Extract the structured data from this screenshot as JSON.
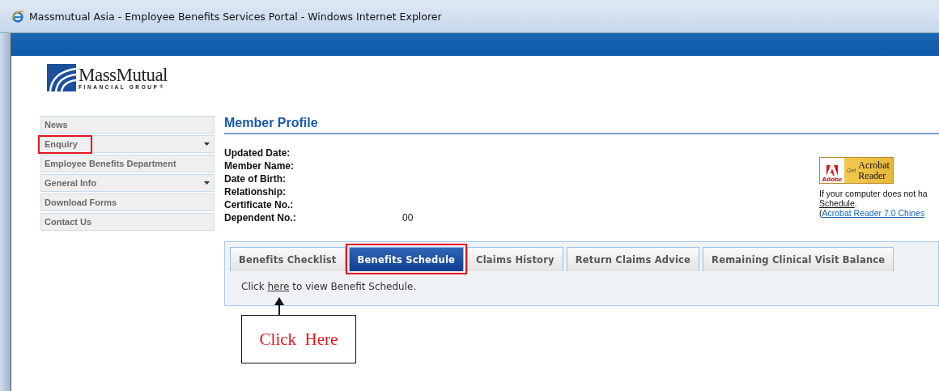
{
  "window": {
    "title": "Massmutual Asia - Employee Benefits Services Portal - Windows Internet Explorer"
  },
  "logo": {
    "name": "MassMutual",
    "tagline": "FINANCIAL GROUP",
    "mark": "®"
  },
  "sidebar": {
    "items": [
      {
        "label": "News",
        "has_submenu": false,
        "annotated": false
      },
      {
        "label": "Enquiry",
        "has_submenu": true,
        "annotated": true
      },
      {
        "label": "Employee Benefits Department",
        "has_submenu": false,
        "annotated": false
      },
      {
        "label": "General Info",
        "has_submenu": true,
        "annotated": false
      },
      {
        "label": "Download Forms",
        "has_submenu": false,
        "annotated": false
      },
      {
        "label": "Contact Us",
        "has_submenu": false,
        "annotated": false
      }
    ]
  },
  "profile": {
    "heading": "Member Profile",
    "fields": [
      {
        "label": "Updated Date:"
      },
      {
        "label": "Member Name:"
      },
      {
        "label": "Date of Birth:"
      },
      {
        "label": "Relationship:"
      },
      {
        "label": "Certificate No.:"
      },
      {
        "label": "Dependent No.:",
        "value": "00"
      }
    ]
  },
  "acrobat": {
    "badge_brand": "Adobe",
    "badge_get": "Get",
    "badge_line1": "Acrobat",
    "badge_line2": "Reader",
    "note": "If your computer does not ha",
    "link": "Schedule",
    "link_after": ".",
    "open_paren": "(",
    "chinese_link": "Acrobat Reader 7.0 Chines"
  },
  "tabs": [
    {
      "label": "Benefits Checklist",
      "selected": false,
      "annotated": false
    },
    {
      "label": "Benefits Schedule",
      "selected": true,
      "annotated": true
    },
    {
      "label": "Claims History",
      "selected": false,
      "annotated": false
    },
    {
      "label": "Return Claims Advice",
      "selected": false,
      "annotated": false
    },
    {
      "label": "Remaining Clinical Visit Balance",
      "selected": false,
      "annotated": false
    }
  ],
  "tab_content": {
    "before": "Click",
    "link": "here",
    "after": "to view Benefit Schedule."
  },
  "callout": {
    "text": "Click  Here"
  }
}
